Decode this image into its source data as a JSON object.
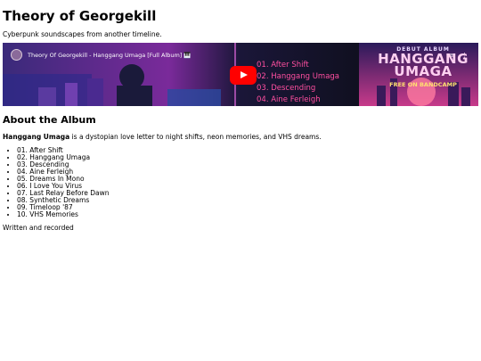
{
  "page": {
    "title": "Theory of Georgekill",
    "tagline": "Cyberpunk soundscapes from another timeline."
  },
  "video": {
    "title": "Theory Of Georgekill - Hanggang Umaga [Full Album] 🎹",
    "overlay_tracks": [
      "01. After Shift",
      "02. Hanggang Umaga",
      "03. Descending",
      "04. Aine Ferleigh"
    ],
    "debut_label": "DEBUT ALBUM",
    "album_name": "HANGGANG UMAGA",
    "cta": "FREE ON BANDCAMP"
  },
  "about": {
    "heading": "About the Album",
    "album_bold": "Hanggang Umaga",
    "description_rest": " is a dystopian love letter to night shifts, neon memories, and VHS dreams.",
    "tracks": [
      "01. After Shift",
      "02. Hanggang Umaga",
      "03. Descending",
      "04. Aine Ferleigh",
      "05. Dreams In Mono",
      "06. I Love You Virus",
      "07. Last Relay Before Dawn",
      "08. Synthetic Dreams",
      "09. Timeloop '87",
      "10. VHS Memories"
    ],
    "credit": "Written and recorded"
  }
}
